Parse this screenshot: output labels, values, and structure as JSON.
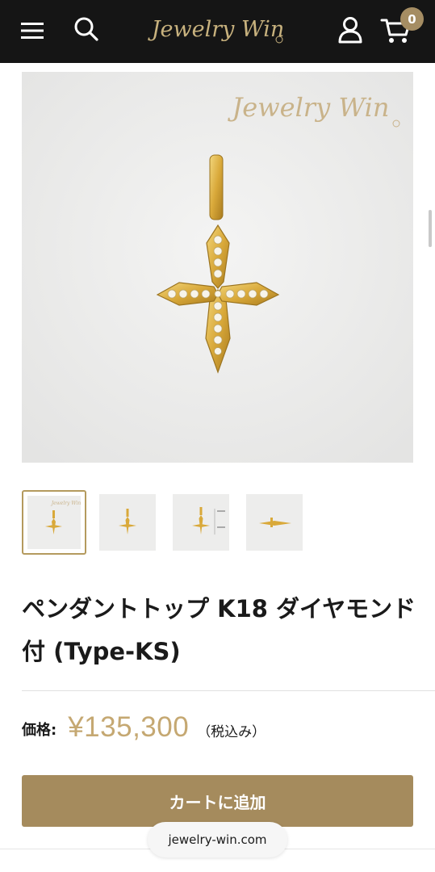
{
  "header": {
    "logo_text": "Jewelry Win",
    "cart_count": "0",
    "icons": [
      "menu-icon",
      "search-icon",
      "account-icon",
      "cart-icon"
    ]
  },
  "gallery": {
    "watermark": "Jewelry Win",
    "thumbnails": [
      {
        "label": "thumb-1",
        "active": true
      },
      {
        "label": "thumb-2",
        "active": false
      },
      {
        "label": "thumb-3",
        "active": false
      },
      {
        "label": "thumb-4",
        "active": false
      }
    ]
  },
  "product": {
    "title": "ペンダントトップ K18 ダイヤモンド付 (Type-KS)",
    "price_label": "価格:",
    "price": "¥135,300",
    "tax_note": "（税込み）",
    "add_to_cart": "カートに追加"
  },
  "browser": {
    "url": "jewelry-win.com"
  },
  "colors": {
    "header_bg": "#151515",
    "accent": "#a58b5d",
    "price": "#c5a872"
  }
}
